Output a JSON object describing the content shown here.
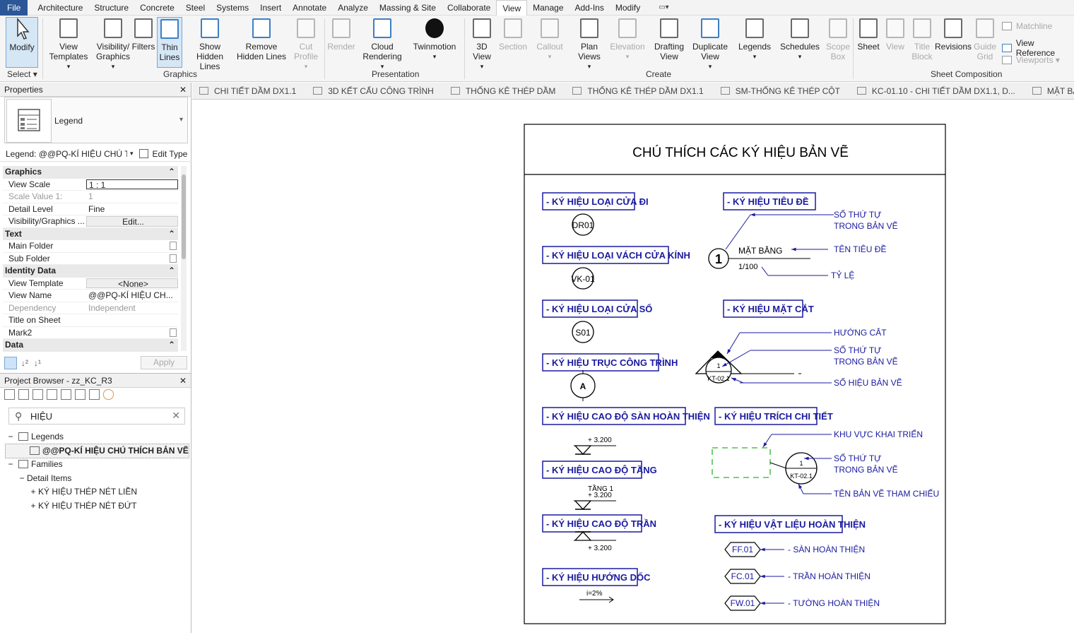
{
  "menubar": {
    "file": "File",
    "items": [
      "Architecture",
      "Structure",
      "Concrete",
      "Steel",
      "Systems",
      "Insert",
      "Annotate",
      "Analyze",
      "Massing & Site",
      "Collaborate",
      "View",
      "Manage",
      "Add-Ins",
      "Modify"
    ],
    "active": "View"
  },
  "ribbon": {
    "modify": "Modify",
    "select": "Select",
    "graphics_group": "Graphics",
    "presentation_group": "Presentation",
    "create_group": "Create",
    "sheet_group": "Sheet Composition",
    "buttons": {
      "view_templates": [
        "View",
        "Templates"
      ],
      "visibility": [
        "Visibility/",
        "Graphics"
      ],
      "filters": [
        "Filters",
        ""
      ],
      "thin_lines": [
        "Thin",
        "Lines"
      ],
      "show_hidden": [
        "Show",
        "Hidden Lines"
      ],
      "remove_hidden": [
        "Remove",
        "Hidden Lines"
      ],
      "cut_profile": [
        "Cut",
        "Profile"
      ],
      "render": [
        "Render",
        ""
      ],
      "cloud_rendering": [
        "Cloud",
        "Rendering"
      ],
      "twinmotion": [
        "Twinmotion",
        ""
      ],
      "view_3d": [
        "3D",
        "View"
      ],
      "section": [
        "Section",
        ""
      ],
      "callout": [
        "Callout",
        ""
      ],
      "plan_views": [
        "Plan",
        "Views"
      ],
      "elevation": [
        "Elevation",
        ""
      ],
      "drafting_view": [
        "Drafting",
        "View"
      ],
      "duplicate_view": [
        "Duplicate",
        "View"
      ],
      "legends": [
        "Legends",
        ""
      ],
      "schedules": [
        "Schedules",
        ""
      ],
      "scope_box": [
        "Scope",
        "Box"
      ],
      "sheet": [
        "Sheet",
        ""
      ],
      "view": [
        "View",
        ""
      ],
      "title_block": [
        "Title",
        "Block"
      ],
      "revisions": [
        "Revisions",
        ""
      ],
      "guide_grid": [
        "Guide",
        "Grid"
      ]
    },
    "small": {
      "matchline": "Matchline",
      "view_reference": "View Reference",
      "viewports": "Viewports"
    }
  },
  "properties": {
    "title": "Properties",
    "type_name": "Legend",
    "instance": "Legend: @@PQ-KÍ HIỆU CHÚ T",
    "edit_type": "Edit Type",
    "apply": "Apply",
    "sections": [
      {
        "name": "Graphics",
        "rows": [
          {
            "k": "View Scale",
            "v": "1 : 1",
            "style": "input"
          },
          {
            "k": "Scale Value    1:",
            "v": "1",
            "style": "dis"
          },
          {
            "k": "Detail Level",
            "v": "Fine",
            "style": ""
          },
          {
            "k": "Visibility/Graphics ...",
            "v": "Edit...",
            "style": "btn"
          }
        ]
      },
      {
        "name": "Text",
        "rows": [
          {
            "k": "Main Folder",
            "v": "",
            "style": "chk"
          },
          {
            "k": "Sub Folder",
            "v": "",
            "style": "chk"
          }
        ]
      },
      {
        "name": "Identity Data",
        "rows": [
          {
            "k": "View Template",
            "v": "<None>",
            "style": "btn"
          },
          {
            "k": "View Name",
            "v": "@@PQ-KÍ HIỆU CH...",
            "style": ""
          },
          {
            "k": "Dependency",
            "v": "Independent",
            "style": "dis"
          },
          {
            "k": "Title on Sheet",
            "v": "",
            "style": ""
          },
          {
            "k": "Mark2",
            "v": "",
            "style": "chk"
          }
        ]
      },
      {
        "name": "Data",
        "rows": []
      }
    ]
  },
  "browser": {
    "title": "Project Browser - zz_KC_R3",
    "search": "HIỆU",
    "tree": [
      {
        "level": 0,
        "exp": "−",
        "label": "Legends",
        "icon": true
      },
      {
        "level": 1,
        "exp": "",
        "label": "@@PQ-KÍ HIỆU CHÚ THÍCH BẢN VẼ",
        "bold": true,
        "sel": true,
        "icon": true
      },
      {
        "level": 0,
        "exp": "−",
        "label": "Families",
        "icon": true
      },
      {
        "level": 1,
        "exp": "−",
        "label": "Detail Items"
      },
      {
        "level": 2,
        "exp": "+",
        "label": "KÝ HIỆU THÉP NÉT LIỀN"
      },
      {
        "level": 2,
        "exp": "+",
        "label": "KÝ HIỆU THÉP NÉT ĐỨT"
      }
    ]
  },
  "tabs": [
    "CHI TIẾT DẦM DX1.1",
    "3D KẾT CẤU CÔNG TRÌNH",
    "THỐNG KÊ THÉP DẦM",
    "THỐNG KÊ THÉP DẦM DX1.1",
    "SM-THỐNG KÊ THÉP CỘT",
    "KC-01.10 - CHI TIẾT DẦM DX1.1, D...",
    "MẶT BẰNG KẾT CẤ"
  ],
  "legend": {
    "title": "CHÚ THÍCH CÁC KÝ HIỆU BẢN VẼ",
    "left": [
      {
        "label": "- KÝ HIỆU LOẠI CỬA ĐI",
        "tag": "DR01"
      },
      {
        "label": "- KÝ HIỆU LOẠI VÁCH CỬA KÍNH",
        "tag": "VK-01"
      },
      {
        "label": "- KÝ HIỆU LOẠI CỬA SỔ",
        "tag": "S01"
      },
      {
        "label": "- KÝ HIỆU TRỤC CÔNG TRÌNH",
        "tag": "A"
      },
      {
        "label": "- KÝ HIỆU CAO ĐỘ SÀN HOÀN THIỆN",
        "tag": "+ 3.200"
      },
      {
        "label": "- KÝ HIỆU CAO ĐỘ TẦNG",
        "tag": "TẦNG 1",
        "tag2": "+ 3.200"
      },
      {
        "label": "- KÝ HIỆU CAO ĐỘ TRẦN",
        "tag": "+ 3.200"
      },
      {
        "label": "- KÝ HIỆU HƯỚNG DỐC",
        "tag": "i=2%"
      }
    ],
    "title_sym": {
      "label": "- KÝ HIỆU TIÊU ĐỀ",
      "num": "1",
      "name": "MẶT BẰNG",
      "scale": "1/100",
      "n1": "SỐ THỨ TỰ",
      "n1b": "TRONG BẢN VẼ",
      "n2": "TÊN TIÊU ĐỀ",
      "n3": "TỶ LỆ"
    },
    "section_sym": {
      "label": "- KÝ HIỆU MẶT CẮT",
      "num": "1",
      "ref": "KT-02.1",
      "n1": "HƯỚNG CẮT",
      "n2": "SỐ THỨ TỰ",
      "n2b": "TRONG BẢN VẼ",
      "n3": "SỐ HIỆU BẢN VẼ"
    },
    "callout_sym": {
      "label": "- KÝ HIỆU TRÍCH CHI TIẾT",
      "num": "1",
      "ref": "KT-02.1",
      "n1": "KHU VỰC KHAI TRIỂN",
      "n2": "SỐ THỨ TỰ",
      "n2b": "TRONG BẢN VẼ",
      "n3": "TÊN BẢN VẼ THAM CHIẾU"
    },
    "material_sym": {
      "label": "- KÝ HIỆU VẬT LIỆU HOÀN THIỆN",
      "items": [
        {
          "tag": "FF.01",
          "text": "- SÀN HOÀN THIỆN"
        },
        {
          "tag": "FC.01",
          "text": "- TRẦN HOÀN THIỆN"
        },
        {
          "tag": "FW.01",
          "text": "- TƯỜNG HOÀN THIỆN"
        }
      ]
    }
  },
  "colors": {
    "accent": "#1a1aa0",
    "callout": "#2ab52a",
    "file": "#2b5797"
  }
}
